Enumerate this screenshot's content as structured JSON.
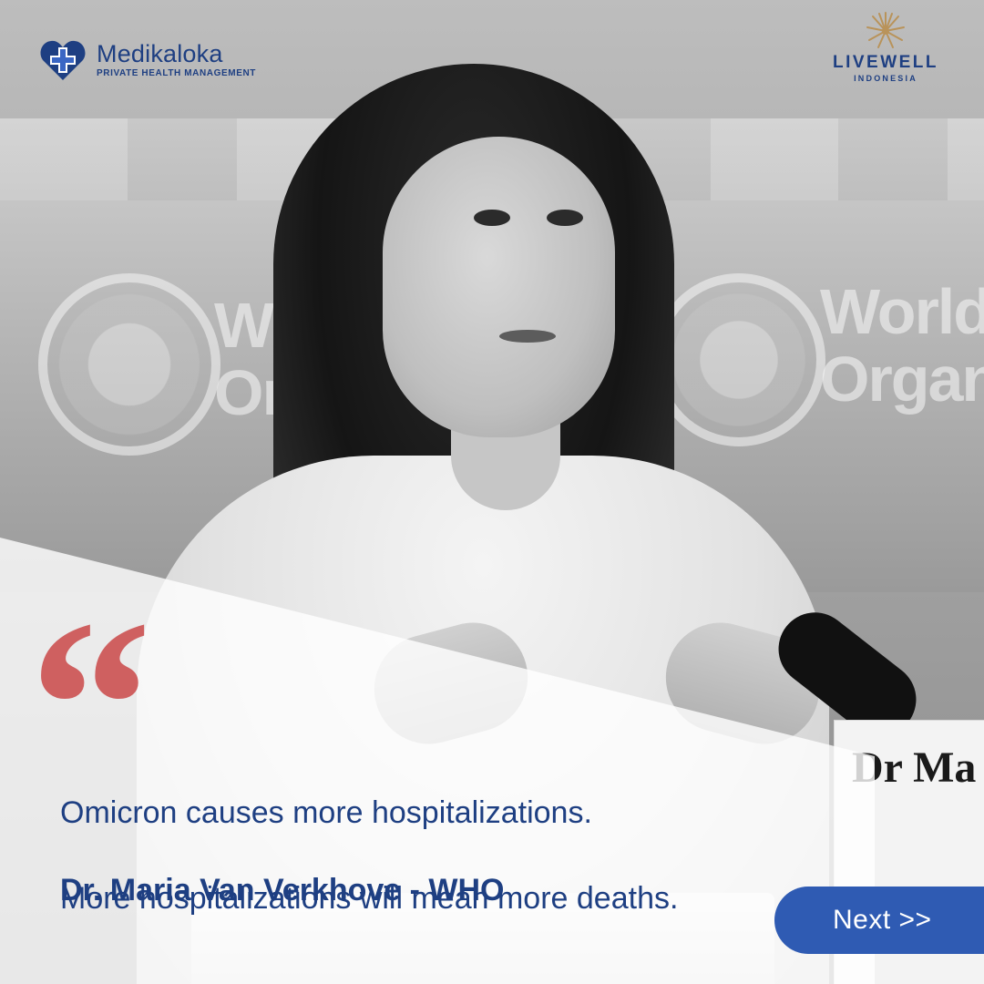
{
  "logos": {
    "left": {
      "title": "Medikaloka",
      "subtitle": "PRIVATE HEALTH MANAGEMENT",
      "icon": "heart-cross-icon"
    },
    "right": {
      "title": "LIVEWELL",
      "subtitle": "INDONESIA",
      "icon": "starburst-icon"
    }
  },
  "quote": {
    "mark": "“",
    "lines": [
      "Omicron causes more hospitalizations.",
      "More hospitalizations will mean more deaths."
    ],
    "attribution": "Dr. Maria Van Verkhove - WHO"
  },
  "background": {
    "emblem_text_left": "World\nOr",
    "emblem_text_right": "World\nOrgani",
    "nameplate_text": "Dr Ma"
  },
  "navigation": {
    "next_label": "Next >>"
  },
  "colors": {
    "brand_blue": "#1e3f82",
    "button_blue": "#2f5bb3",
    "quote_red": "#c63838"
  }
}
